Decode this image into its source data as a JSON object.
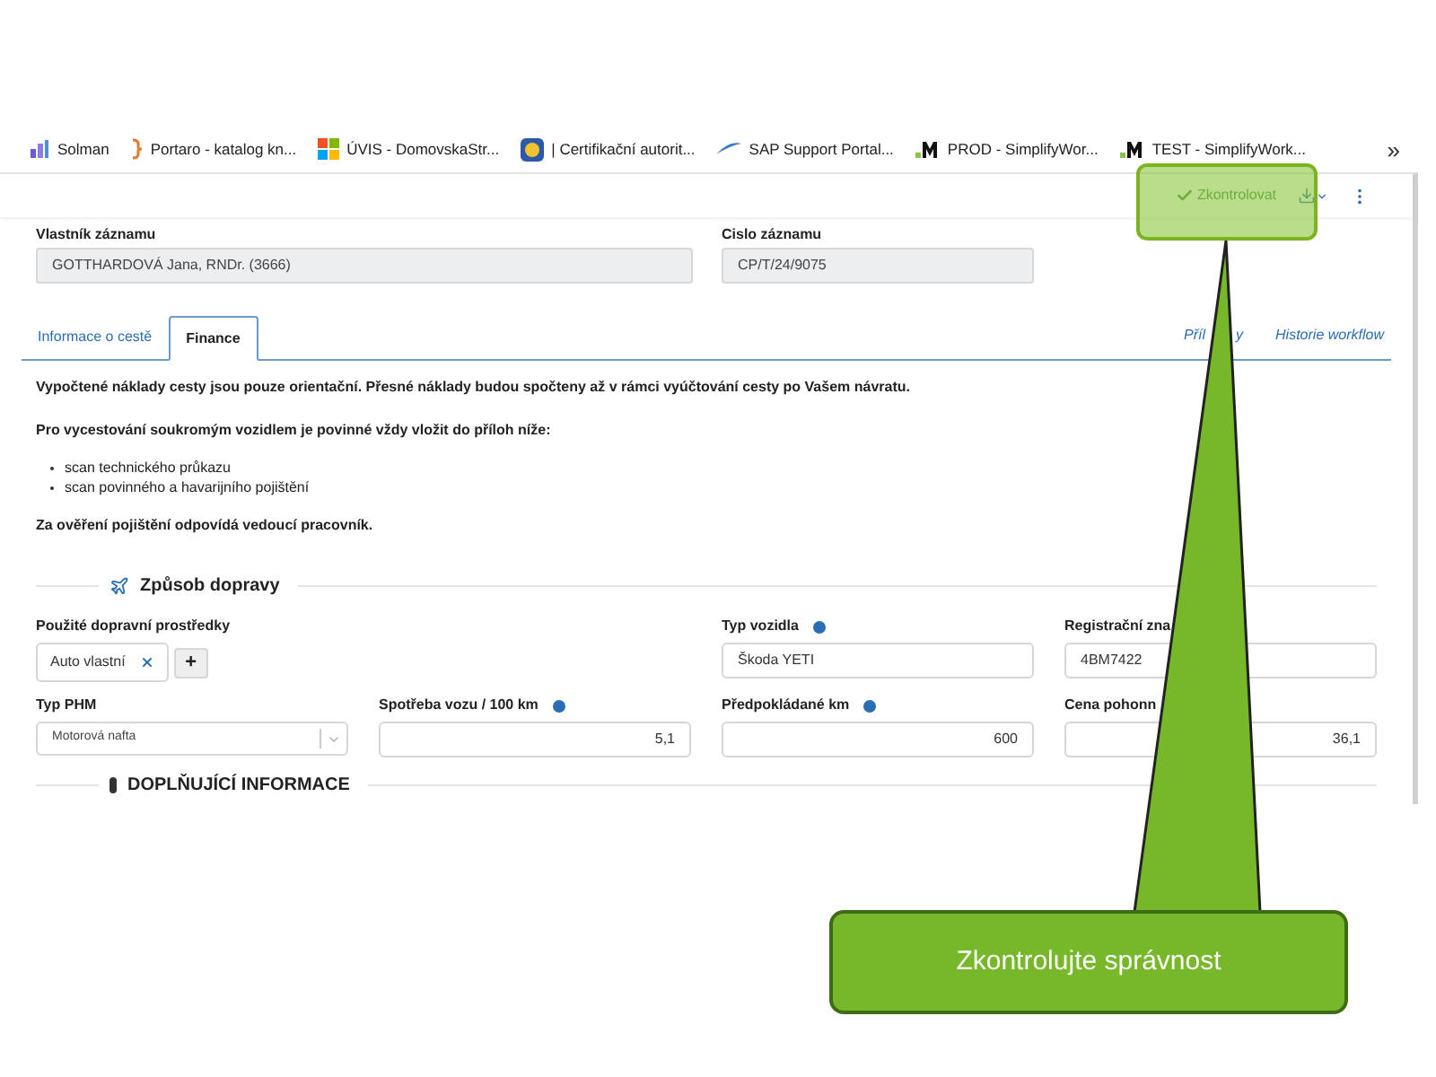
{
  "bookmarks": [
    {
      "label": "Solman",
      "kind": "bars"
    },
    {
      "label": "Portaro - katalog kn...",
      "kind": "brace"
    },
    {
      "label": "ÚVIS - DomovskaStr...",
      "kind": "tiles"
    },
    {
      "label": "| Certifikační autorit...",
      "kind": "badge"
    },
    {
      "label": "SAP Support Portal...",
      "kind": "wing"
    },
    {
      "label": "PROD - SimplifyWor...",
      "kind": "letter"
    },
    {
      "label": "TEST - SimplifyWork...",
      "kind": "letter"
    }
  ],
  "bookmarks_more": "»",
  "toolbar": {
    "check_button": "Zkontrolovat"
  },
  "record": [
    {
      "label": "Vlastník záznamu",
      "value": "GOTTHARDOVÁ Jana, RNDr. (3666)"
    },
    {
      "label": "Cislo záznamu",
      "value": "CP/T/24/9075"
    }
  ],
  "tabs": [
    {
      "label": "Informace o cestě",
      "selected": false
    },
    {
      "label": "Finance",
      "selected": true
    }
  ],
  "attachments_link_parts": [
    "Příl",
    "y"
  ],
  "links": [
    "Historie workflow"
  ],
  "notes": {
    "intro": "Vypočtené náklady cesty jsou pouze orientační. Přesné náklady budou spočteny až v rámci vyúčtování cesty po Vašem návratu.",
    "private_vehicle": "Pro vycestování soukromým vozidlem je povinné vždy vložit do příloh níže:",
    "items": [
      "scan technického průkazu",
      "scan povinného a havarijního pojištění"
    ],
    "verification": "Za ověření pojištění odpovídá vedoucí pracovník."
  },
  "transport": {
    "heading": "Způsob dopravy",
    "means_label": "Použité dopravní prostředky",
    "means": [
      "Auto vlastní"
    ],
    "add": "+",
    "vehicle": {
      "label": "Typ vozidla",
      "value": "Škoda YETI"
    },
    "registration": {
      "label": "Registrační zna",
      "value": "4BM7422"
    },
    "fuel": {
      "label": "Typ PHM",
      "value": "Motorová nafta"
    },
    "consumption": {
      "label": "Spotřeba vozu / 100 km",
      "value": "5,1"
    },
    "distance": {
      "label": "Předpokládané km",
      "value": "600"
    },
    "price": {
      "label": "Cena pohonn",
      "value": "36,1"
    }
  },
  "additional_heading": "DOPLŇUJÍCÍ INFORMACE",
  "callout": "Zkontrolujte správnost"
}
